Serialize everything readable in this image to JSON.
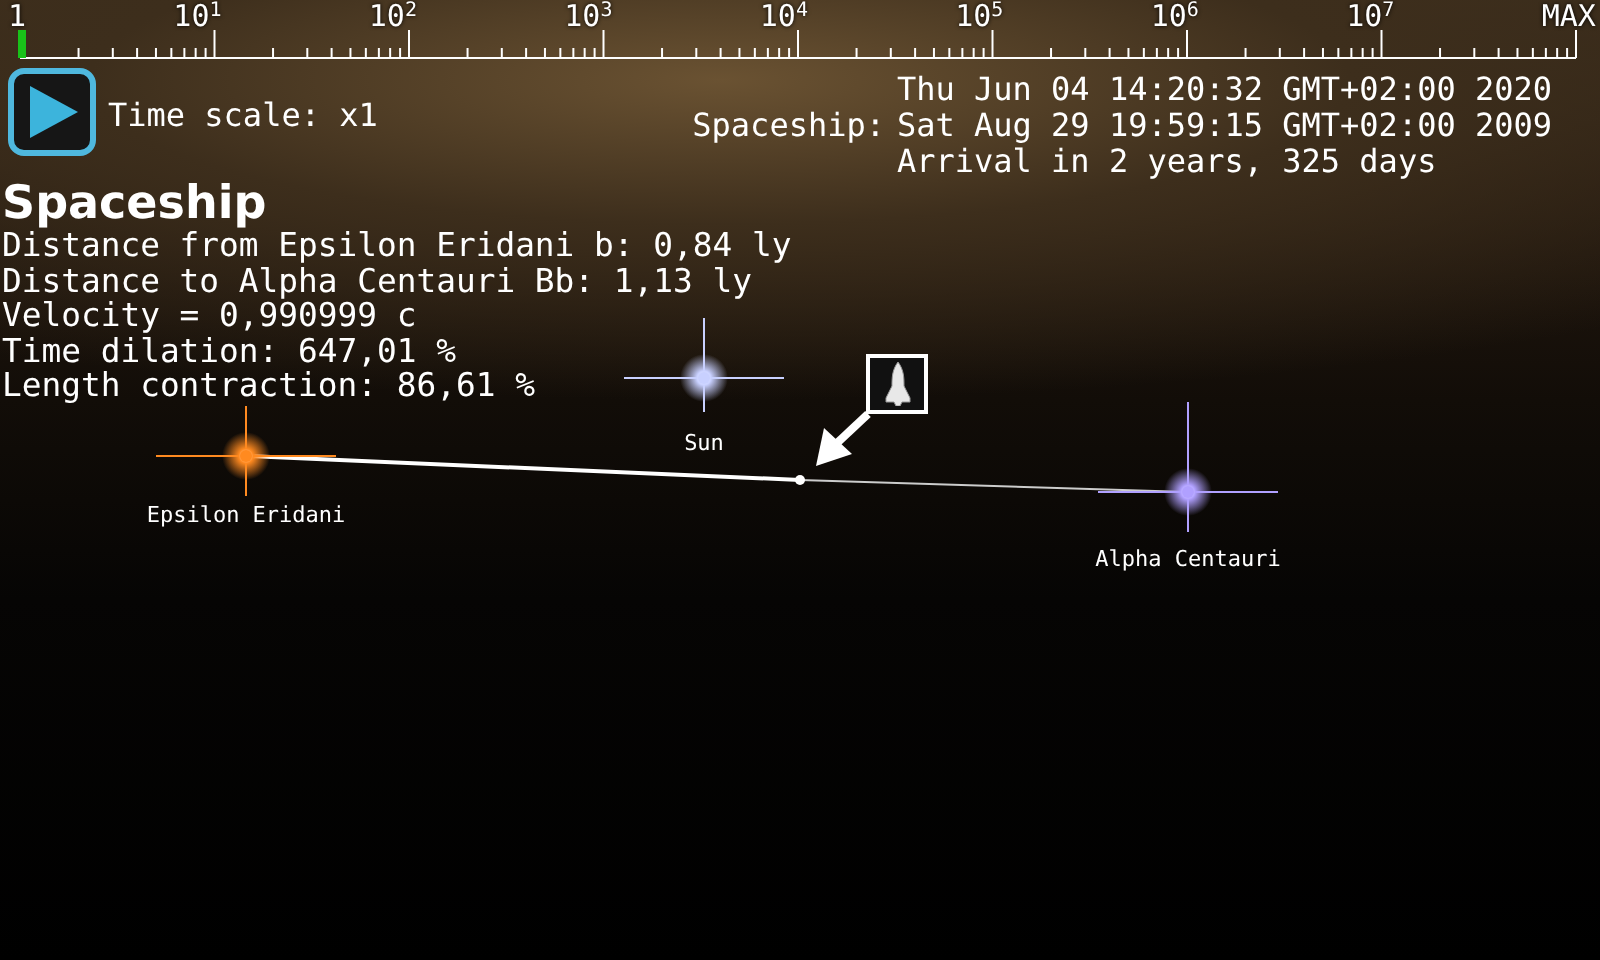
{
  "time_scale_bar": {
    "labels": [
      "1",
      "10$^{1}$",
      "10$^{2}$",
      "10$^{3}$",
      "10$^{4}$",
      "10$^{5}$",
      "10$^{6}$",
      "10$^{7}$",
      "MAX"
    ],
    "level": 0
  },
  "time_scale": "Time scale: x1",
  "clock": {
    "earth_time": "Thu Jun 04 14:20:32 GMT+02:00 2020",
    "ship_label": "Spaceship:",
    "ship_time": "Sat Aug 29 19:59:15 GMT+02:00 2009",
    "arrival": "Arrival in 2 years, 325 days"
  },
  "info": {
    "title": "Spaceship",
    "lines": [
      "Distance from Epsilon Eridani b: 0,84 ly",
      "Distance to Alpha Centauri Bb: 1,13 ly",
      "Velocity = 0,990999 c",
      "Time dilation: 647,01 %",
      "Length contraction: 86,61 %"
    ]
  },
  "map": {
    "stars": [
      {
        "name": "Epsilon Eridani",
        "color": "#ff8a20"
      },
      {
        "name": "Sun",
        "color": "#c8d0ff"
      },
      {
        "name": "Alpha Centauri",
        "color": "#b0a0ff"
      }
    ]
  }
}
